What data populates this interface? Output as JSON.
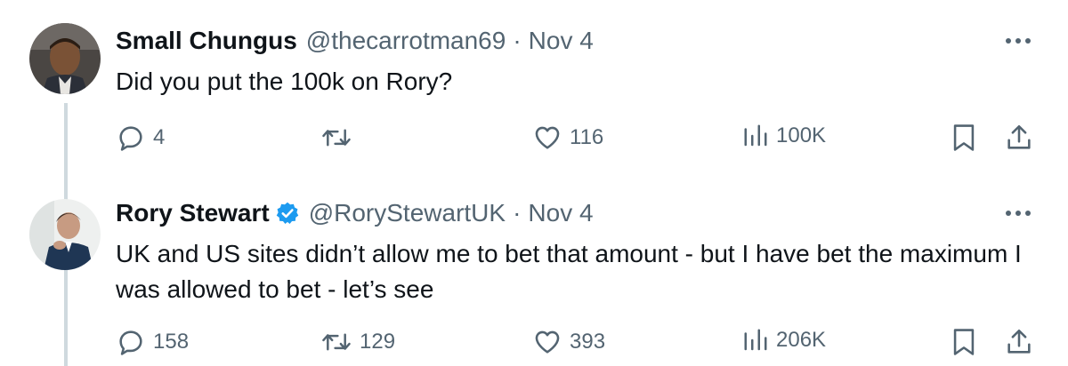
{
  "tweets": [
    {
      "display_name": "Small Chungus",
      "handle": "@thecarrotman69",
      "separator": "·",
      "date": "Nov 4",
      "verified": false,
      "text": "Did you put the 100k on Rory?",
      "replies": "4",
      "retweets": "",
      "likes": "116",
      "views": "100K"
    },
    {
      "display_name": "Rory Stewart",
      "handle": "@RoryStewartUK",
      "separator": "·",
      "date": "Nov 4",
      "verified": true,
      "text": "UK and US sites didn’t allow me to bet that amount - but I have bet the maximum I was allowed to bet - let’s see",
      "replies": "158",
      "retweets": "129",
      "likes": "393",
      "views": "206K"
    }
  ],
  "colors": {
    "text_primary": "#0f1419",
    "text_secondary": "#536471",
    "verified": "#1d9bf0",
    "thread_line": "#cfd9de"
  },
  "icons": [
    "reply-icon",
    "retweet-icon",
    "like-icon",
    "views-icon",
    "bookmark-icon",
    "share-icon",
    "more-icon",
    "verified-badge-icon"
  ]
}
